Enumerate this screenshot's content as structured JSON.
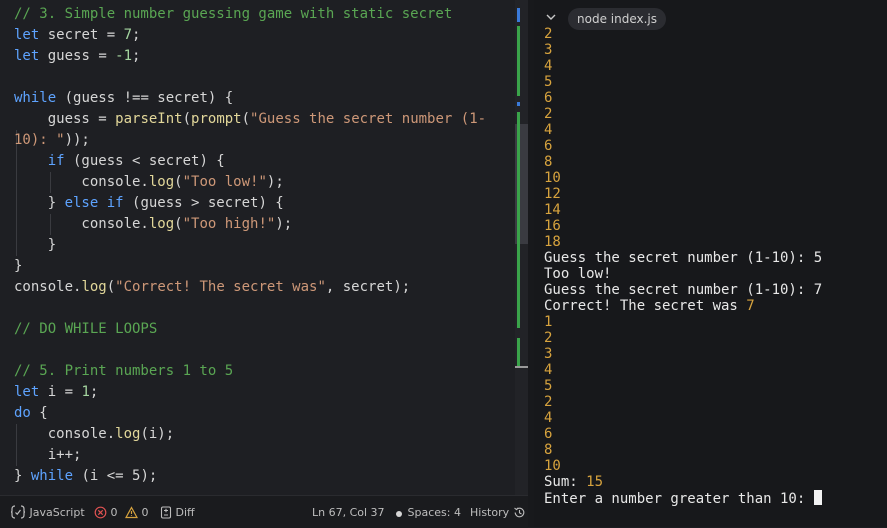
{
  "editor": {
    "lines": [
      [
        {
          "t": "cm",
          "v": "// 3. Simple number guessing game with static secret"
        }
      ],
      [
        {
          "t": "kw",
          "v": "let"
        },
        {
          "t": "id",
          "v": " secret "
        },
        {
          "t": "op",
          "v": "= "
        },
        {
          "t": "num",
          "v": "7"
        },
        {
          "t": "op",
          "v": ";"
        }
      ],
      [
        {
          "t": "kw",
          "v": "let"
        },
        {
          "t": "id",
          "v": " guess "
        },
        {
          "t": "op",
          "v": "= "
        },
        {
          "t": "num",
          "v": "-1"
        },
        {
          "t": "op",
          "v": ";"
        }
      ],
      [],
      [
        {
          "t": "kw",
          "v": "while"
        },
        {
          "t": "op",
          "v": " (guess !== secret) {"
        }
      ],
      [
        {
          "t": "id",
          "v": "    guess "
        },
        {
          "t": "op",
          "v": "= "
        },
        {
          "t": "fn",
          "v": "parseInt"
        },
        {
          "t": "op",
          "v": "("
        },
        {
          "t": "fn",
          "v": "prompt"
        },
        {
          "t": "op",
          "v": "("
        },
        {
          "t": "str",
          "v": "\"Guess the secret number (1-"
        }
      ],
      [
        {
          "t": "str",
          "v": "10): \""
        },
        {
          "t": "op",
          "v": "));"
        }
      ],
      [
        {
          "t": "kw",
          "v": "    if"
        },
        {
          "t": "op",
          "v": " (guess < secret) {"
        }
      ],
      [
        {
          "t": "id",
          "v": "        console."
        },
        {
          "t": "fn",
          "v": "log"
        },
        {
          "t": "op",
          "v": "("
        },
        {
          "t": "str",
          "v": "\"Too low!\""
        },
        {
          "t": "op",
          "v": ");"
        }
      ],
      [
        {
          "t": "op",
          "v": "    } "
        },
        {
          "t": "kw",
          "v": "else if"
        },
        {
          "t": "op",
          "v": " (guess > secret) {"
        }
      ],
      [
        {
          "t": "id",
          "v": "        console."
        },
        {
          "t": "fn",
          "v": "log"
        },
        {
          "t": "op",
          "v": "("
        },
        {
          "t": "str",
          "v": "\"Too high!\""
        },
        {
          "t": "op",
          "v": ");"
        }
      ],
      [
        {
          "t": "op",
          "v": "    }"
        }
      ],
      [
        {
          "t": "op",
          "v": "}"
        }
      ],
      [
        {
          "t": "id",
          "v": "console."
        },
        {
          "t": "fn",
          "v": "log"
        },
        {
          "t": "op",
          "v": "("
        },
        {
          "t": "str",
          "v": "\"Correct! The secret was\""
        },
        {
          "t": "op",
          "v": ", secret);"
        }
      ],
      [],
      [
        {
          "t": "cm",
          "v": "// DO WHILE LOOPS"
        }
      ],
      [],
      [
        {
          "t": "cm",
          "v": "// 5. Print numbers 1 to 5"
        }
      ],
      [
        {
          "t": "kw",
          "v": "let"
        },
        {
          "t": "id",
          "v": " i "
        },
        {
          "t": "op",
          "v": "= "
        },
        {
          "t": "num",
          "v": "1"
        },
        {
          "t": "op",
          "v": ";"
        }
      ],
      [
        {
          "t": "kw",
          "v": "do"
        },
        {
          "t": "op",
          "v": " {"
        }
      ],
      [
        {
          "t": "id",
          "v": "    console."
        },
        {
          "t": "fn",
          "v": "log"
        },
        {
          "t": "op",
          "v": "(i);"
        }
      ],
      [
        {
          "t": "id",
          "v": "    i++;"
        }
      ],
      [
        {
          "t": "op",
          "v": "} "
        },
        {
          "t": "kw",
          "v": "while"
        },
        {
          "t": "op",
          "v": " (i <= 5);"
        }
      ]
    ]
  },
  "terminal": {
    "tab_label": "node index.js",
    "lines": [
      [
        {
          "t": "num",
          "v": "2"
        }
      ],
      [
        {
          "t": "num",
          "v": "3"
        }
      ],
      [
        {
          "t": "num",
          "v": "4"
        }
      ],
      [
        {
          "t": "num",
          "v": "5"
        }
      ],
      [
        {
          "t": "num",
          "v": "6"
        }
      ],
      [
        {
          "t": "num",
          "v": "2"
        }
      ],
      [
        {
          "t": "num",
          "v": "4"
        }
      ],
      [
        {
          "t": "num",
          "v": "6"
        }
      ],
      [
        {
          "t": "num",
          "v": "8"
        }
      ],
      [
        {
          "t": "num",
          "v": "10"
        }
      ],
      [
        {
          "t": "num",
          "v": "12"
        }
      ],
      [
        {
          "t": "num",
          "v": "14"
        }
      ],
      [
        {
          "t": "num",
          "v": "16"
        }
      ],
      [
        {
          "t": "num",
          "v": "18"
        }
      ],
      [
        {
          "t": "txt",
          "v": "Guess the secret number (1-10): 5"
        }
      ],
      [
        {
          "t": "txt",
          "v": "Too low!"
        }
      ],
      [
        {
          "t": "txt",
          "v": "Guess the secret number (1-10): 7"
        }
      ],
      [
        {
          "t": "txt",
          "v": "Correct! The secret was "
        },
        {
          "t": "num",
          "v": "7"
        }
      ],
      [
        {
          "t": "num",
          "v": "1"
        }
      ],
      [
        {
          "t": "num",
          "v": "2"
        }
      ],
      [
        {
          "t": "num",
          "v": "3"
        }
      ],
      [
        {
          "t": "num",
          "v": "4"
        }
      ],
      [
        {
          "t": "num",
          "v": "5"
        }
      ],
      [
        {
          "t": "num",
          "v": "2"
        }
      ],
      [
        {
          "t": "num",
          "v": "4"
        }
      ],
      [
        {
          "t": "num",
          "v": "6"
        }
      ],
      [
        {
          "t": "num",
          "v": "8"
        }
      ],
      [
        {
          "t": "num",
          "v": "10"
        }
      ],
      [
        {
          "t": "txt",
          "v": "Sum: "
        },
        {
          "t": "num",
          "v": "15"
        }
      ],
      [
        {
          "t": "txt",
          "v": "Enter a number greater than 10: "
        },
        {
          "t": "cursor",
          "v": ""
        }
      ]
    ]
  },
  "statusbar": {
    "language_icon": "braces-icon",
    "language": "JavaScript",
    "errors_icon": "error-circle-icon",
    "errors": "0",
    "warnings_icon": "warning-triangle-icon",
    "warnings": "0",
    "diff_icon": "diff-icon",
    "diff": "Diff",
    "cursor_position": "Ln 67, Col 37",
    "spaces_icon": "dot-icon",
    "spaces": "Spaces: 4",
    "history": "History",
    "history_icon": "history-icon"
  },
  "colors": {
    "comment": "#5aa653",
    "keyword": "#5ea3ff",
    "function": "#e2d79a",
    "string": "#ce9878",
    "number": "#a5d6a0",
    "terminal_number": "#d7a33e",
    "error": "#e05252",
    "warning": "#d7a33e"
  }
}
